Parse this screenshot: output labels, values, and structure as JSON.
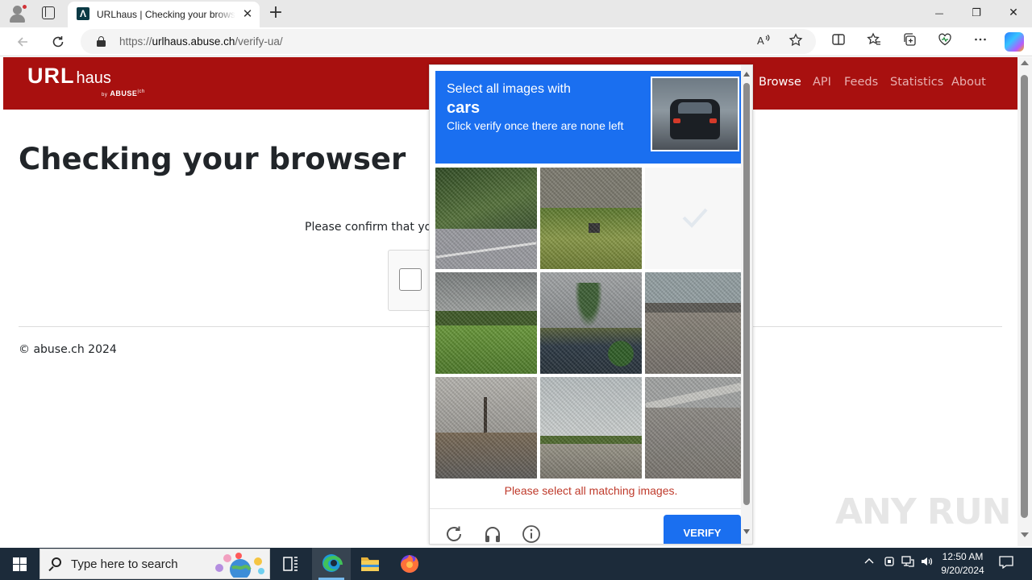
{
  "browser": {
    "tab_title": "URLhaus | Checking your browser",
    "favicon_glyph": "Λ",
    "close_tab_glyph": "✕",
    "new_tab_glyph": "+",
    "url_prefix": "https://",
    "url_domain": "urlhaus.abuse.ch",
    "url_path": "/verify-ua/",
    "window_controls": {
      "minimize": "—",
      "restore": "❐",
      "close": "✕"
    },
    "toolbar_icons": [
      "read-aloud-icon",
      "favorite-star-icon",
      "split-screen-icon",
      "favorites-icon",
      "collections-icon",
      "browser-essentials-icon",
      "more-menu-icon",
      "copilot-icon"
    ]
  },
  "site": {
    "logo_url": "URL",
    "logo_haus": "haus",
    "logo_by": "by",
    "logo_abuse": "ABUSE",
    "logo_ch": "|ch",
    "brand_color": "#a8100f",
    "nav": [
      {
        "label": "Browse",
        "active": true
      },
      {
        "label": "API",
        "active": false
      },
      {
        "label": "Feeds",
        "active": false
      },
      {
        "label": "Statistics",
        "active": false
      },
      {
        "label": "About",
        "active": false
      }
    ]
  },
  "main": {
    "title": "Checking your browser",
    "confirm_text": "Please confirm that yo",
    "footer": "© abuse.ch 2024"
  },
  "captcha": {
    "prompt_line1": "Select all images with",
    "prompt_target": "cars",
    "prompt_line3": "Click verify once there are none left",
    "error": "Please select all matching images.",
    "verify_label": "VERIFY",
    "accent_color": "#1a6ff0",
    "error_color": "#bf3a2b",
    "tiles": [
      {
        "label": "hedge over parking lines",
        "sky": "#3f5a32",
        "ground": "#9a9aa0"
      },
      {
        "label": "shrubs with sign",
        "sky": "#7c7a6e",
        "ground": "#6d8a3a"
      },
      {
        "label": "blank selected tile",
        "sky": "#f6f6f6",
        "ground": "#f6f6f6"
      },
      {
        "label": "grassy hill",
        "sky": "#8a8c8c",
        "ground": "#5d8a33"
      },
      {
        "label": "palm by building",
        "sky": "#9a9c9e",
        "ground": "#2e3a44"
      },
      {
        "label": "road under bridge",
        "sky": "#8d9a9e",
        "ground": "#8a8278"
      },
      {
        "label": "street with palms",
        "sky": "#a9a7a3",
        "ground": "#6e6c68"
      },
      {
        "label": "field and orchard",
        "sky": "#c2c7c8",
        "ground": "#8a8a7c"
      },
      {
        "label": "guardrail road",
        "sky": "#9da0a0",
        "ground": "#8d8a86"
      }
    ],
    "footer_icons": [
      "refresh-icon",
      "audio-challenge-icon",
      "info-icon"
    ]
  },
  "watermark": "ANY RUN",
  "taskbar": {
    "search_placeholder": "Type here to search",
    "time": "12:50 AM",
    "date": "9/20/2024",
    "apps": [
      "task-view-icon",
      "edge-icon",
      "file-explorer-icon",
      "firefox-icon"
    ]
  }
}
